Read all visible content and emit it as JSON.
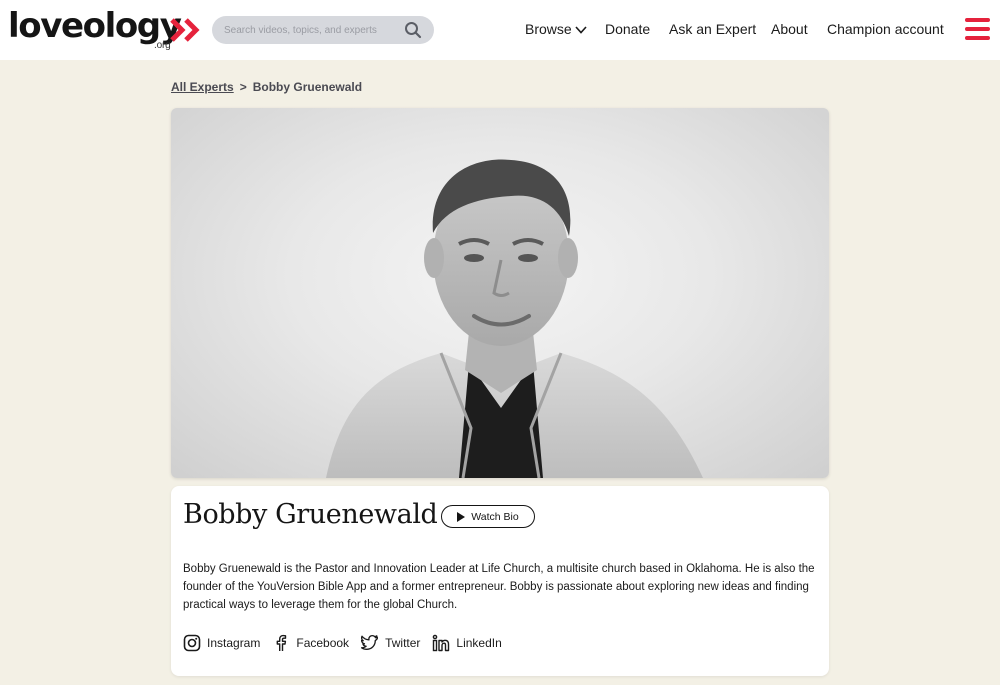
{
  "header": {
    "logo": {
      "word": "loveology",
      "suffix": ".org"
    },
    "search": {
      "placeholder": "Search videos, topics, and experts"
    },
    "nav": {
      "browse": "Browse",
      "donate": "Donate",
      "ask_expert": "Ask an Expert",
      "about": "About",
      "champion": "Champion account"
    }
  },
  "breadcrumb": {
    "parent": "All Experts",
    "separator": ">",
    "current": "Bobby Gruenewald"
  },
  "expert": {
    "name": "Bobby Gruenewald",
    "watch_bio_label": "Watch Bio",
    "bio": "Bobby Gruenewald is the Pastor and Innovation Leader at Life Church, a multisite church based in Oklahoma. He is also the founder of the YouVersion Bible App and a former entrepreneur. Bobby is passionate about exploring new ideas and finding practical ways to leverage them for the global Church.",
    "socials": [
      {
        "label": "Instagram",
        "icon": "instagram-icon"
      },
      {
        "label": "Facebook",
        "icon": "facebook-icon"
      },
      {
        "label": "Twitter",
        "icon": "twitter-icon"
      },
      {
        "label": "LinkedIn",
        "icon": "linkedin-icon"
      }
    ]
  },
  "colors": {
    "brand_red": "#e5223c",
    "page_background": "#f3f0e5",
    "search_background": "#d6d8dd"
  }
}
